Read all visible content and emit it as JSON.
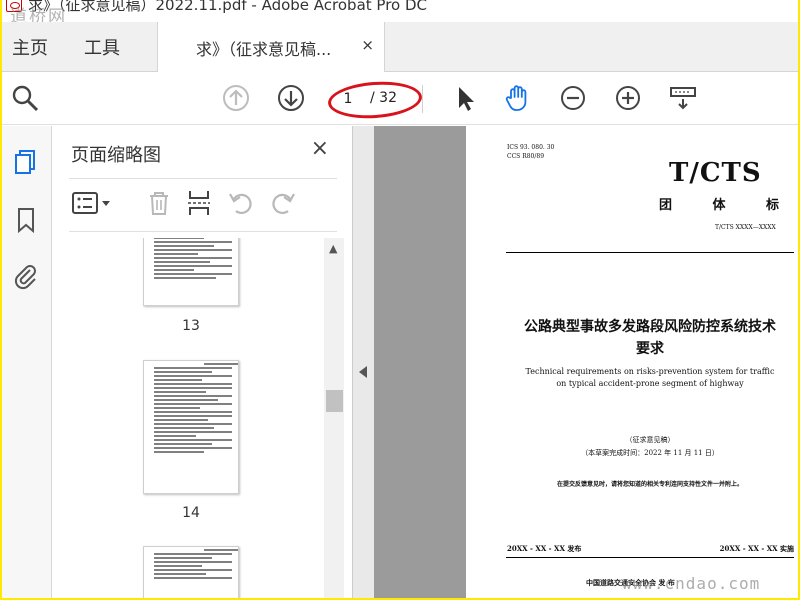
{
  "window": {
    "title": "求》（征求意见稿）2022.11.pdf - Adobe Acrobat Pro DC",
    "watermark": "道桥网"
  },
  "tabs": {
    "home": "主页",
    "tools": "工具",
    "document_tab": "求》（征求意见稿...",
    "close": "×"
  },
  "toolbar": {
    "icons": [
      "zoom-search-icon",
      "prev-page-icon",
      "next-page-icon",
      "select-arrow-icon",
      "hand-icon",
      "zoom-out-icon",
      "zoom-in-icon",
      "read-mode-icon"
    ],
    "page_current": "1",
    "page_total": "/ 32"
  },
  "rail": {
    "icons": [
      "page-thumbnails-icon",
      "bookmark-icon",
      "attachment-icon"
    ]
  },
  "thumbnail_panel": {
    "title": "页面缩略图",
    "close": "×",
    "tool_icons": [
      "options-menu-icon",
      "delete-icon",
      "insert-page-icon",
      "rotate-left-icon",
      "rotate-right-icon"
    ],
    "pages": [
      {
        "label": "13"
      },
      {
        "label": "14"
      },
      {
        "label": ""
      }
    ]
  },
  "document": {
    "ics": "ICS  93. 080. 30",
    "ccs": "CCS  R80/89",
    "code": "T/CTS",
    "type": "团 体 标 准",
    "number": "T/CTS XXXX—XXXX",
    "title_cn_line1": "公路典型事故多发路段风险防控系统技术",
    "title_cn_line2": "要求",
    "title_en_line1": "Technical requirements on risks-prevention system for traffic",
    "title_en_line2": "on typical accident-prone segment of highway",
    "draft_label": "（征求意见稿）",
    "draft_date": "（本草案完成时间：2022 年 11 月 11 日）",
    "notice": "在提交反馈意见时，请将您知道的相关专利连同支持性文件一并附上。",
    "publish": "20XX - XX - XX 发布",
    "implement": "20XX - XX - XX 实施",
    "issuer": "中国道路交通安全协会    发  布"
  },
  "watermark_bottom": "www.cndao.com"
}
